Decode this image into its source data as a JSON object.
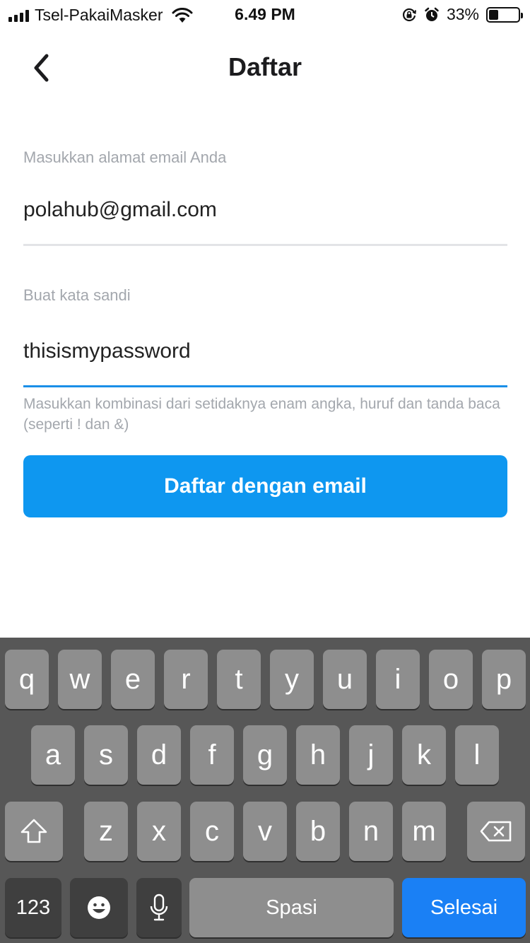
{
  "status_bar": {
    "carrier": "Tsel-PakaiMasker",
    "time": "6.49 PM",
    "battery_percent": "33%",
    "battery_level": 0.33,
    "icons": [
      "signal-icon",
      "wifi-icon",
      "rotation-lock-icon",
      "alarm-icon",
      "battery-icon"
    ]
  },
  "nav": {
    "title": "Daftar",
    "back_icon": "chevron-left-icon"
  },
  "form": {
    "email_label": "Masukkan alamat email Anda",
    "email_value": "polahub@gmail.com",
    "password_label": "Buat kata sandi",
    "password_value": "thisismypassword",
    "password_hint": "Masukkan kombinasi dari setidaknya enam angka, huruf dan tanda baca (seperti ! dan &)",
    "submit_label": "Daftar dengan email"
  },
  "keyboard": {
    "row1": [
      "q",
      "w",
      "e",
      "r",
      "t",
      "y",
      "u",
      "i",
      "o",
      "p"
    ],
    "row2": [
      "a",
      "s",
      "d",
      "f",
      "g",
      "h",
      "j",
      "k",
      "l"
    ],
    "row3": [
      "z",
      "x",
      "c",
      "v",
      "b",
      "n",
      "m"
    ],
    "numbers_label": "123",
    "space_label": "Spasi",
    "done_label": "Selesai",
    "icons": [
      "shift-icon",
      "backspace-icon",
      "emoji-icon",
      "microphone-icon"
    ]
  },
  "colors": {
    "accent": "#0e97f0",
    "active_underline": "#1a8fe8",
    "label_gray": "#a3a7ad",
    "keyboard_bg": "#575757",
    "key_bg": "#8e8e8e",
    "done_key": "#1a80f5"
  }
}
